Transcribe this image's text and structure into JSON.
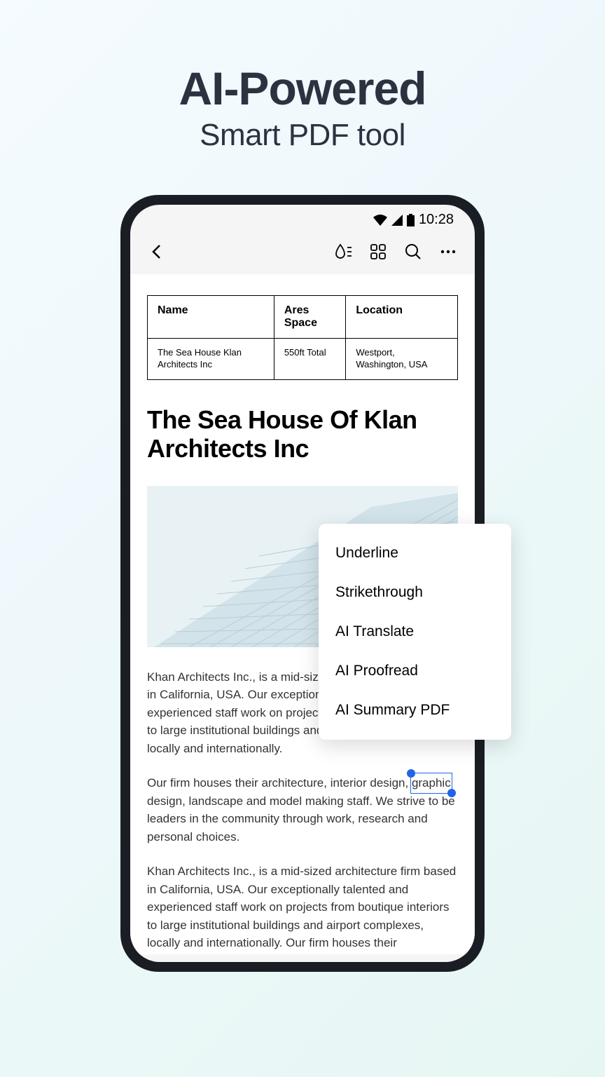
{
  "hero": {
    "title": "AI-Powered",
    "subtitle": "Smart PDF tool"
  },
  "statusbar": {
    "time": "10:28"
  },
  "table": {
    "headers": [
      "Name",
      "Ares Space",
      "Location"
    ],
    "cells": [
      "The Sea House Klan Architects Inc",
      "550ft Total",
      "Westport, Washington, USA"
    ]
  },
  "document": {
    "title": "The Sea House Of Klan Architects Inc",
    "para1": "Khan Architects Inc., is a mid-sized architecture firm based in California, USA. Our exceptionally talented and experienced staff work on projects from boutique interiors to large institutional buildings and airport complexes, locally and internationally.",
    "para2_pre": "Our firm houses their architecture, interior design, ",
    "para2_selected": "graphic",
    "para2_post": " design, landscape and model making staff. We strive to be leaders in the community through work, research and personal choices.",
    "para3": "Khan Architects Inc., is a mid-sized architecture firm based in California, USA. Our exceptionally talented and experienced staff work on projects from boutique interiors to large institutional buildings and airport complexes, locally and internationally. Our firm houses their architecture, interior design,"
  },
  "context_menu": {
    "items": [
      "Underline",
      "Strikethrough",
      "AI Translate",
      "AI Proofread",
      "AI Summary PDF"
    ]
  }
}
